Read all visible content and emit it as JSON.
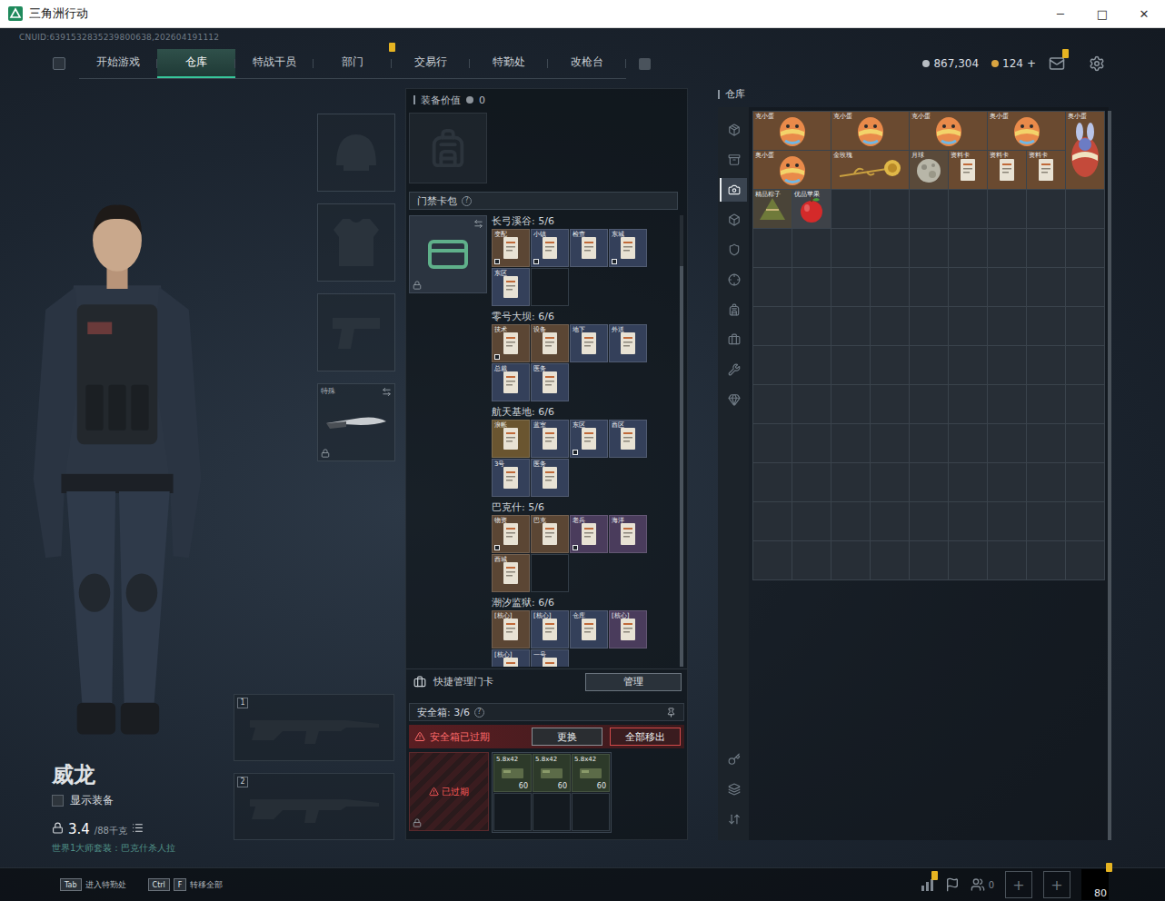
{
  "window": {
    "title": "三角洲行动",
    "controls": [
      "─",
      "□",
      "✕"
    ]
  },
  "header": {
    "uid": "CNUID:6391532835239800638,202604191112",
    "tabs": [
      {
        "label": "开始游戏",
        "selected": false,
        "badge": false
      },
      {
        "label": "仓库",
        "selected": true,
        "badge": false
      },
      {
        "label": "特战干员",
        "selected": false,
        "badge": false
      },
      {
        "label": "部门",
        "selected": false,
        "badge": true
      },
      {
        "label": "交易行",
        "selected": false,
        "badge": false
      },
      {
        "label": "特勤处",
        "selected": false,
        "badge": false
      },
      {
        "label": "改枪台",
        "selected": false,
        "badge": false
      }
    ],
    "currencies": [
      {
        "amount": "867,304",
        "color": "#b7bcc2"
      },
      {
        "amount": "124",
        "color": "#d9a441"
      }
    ],
    "add": "+",
    "mail_badge": true
  },
  "operator": {
    "name": "威龙",
    "show_equipment": {
      "label": "显示装备",
      "checked": false
    },
    "weight": "3.4",
    "weight_max": "/88千克",
    "status": "世界1大师套装：巴克什杀人拉"
  },
  "equipment": {
    "slots": [
      {
        "kind": "helmet",
        "filled": false,
        "locked": false
      },
      {
        "kind": "armor",
        "filled": false,
        "locked": false
      },
      {
        "kind": "pistol",
        "filled": false,
        "locked": false
      },
      {
        "kind": "melee",
        "filled": true,
        "label": "特殊",
        "locked": true
      }
    ],
    "weapons": [
      {
        "label": "1",
        "filled": false
      },
      {
        "label": "2",
        "filled": false
      }
    ]
  },
  "loadout": {
    "value_label": "装备价值",
    "value": "0",
    "backpack_filled": false,
    "keycards": {
      "title": "门禁卡包",
      "help": "?",
      "locked": true,
      "maps": [
        {
          "name": "长弓溪谷: 5/6",
          "capacity": 6,
          "cards": [
            {
              "label": "变配",
              "color": "#5b4634",
              "marked": true
            },
            {
              "label": "小镇",
              "color": "#34405a",
              "marked": true
            },
            {
              "label": "检查",
              "color": "#34405a",
              "marked": false
            },
            {
              "label": "东城",
              "color": "#34405a",
              "marked": true
            },
            {
              "label": "东区",
              "color": "#34405a",
              "marked": false
            }
          ]
        },
        {
          "name": "零号大坝: 6/6",
          "capacity": 6,
          "cards": [
            {
              "label": "技术",
              "color": "#5b4634",
              "marked": true
            },
            {
              "label": "设备",
              "color": "#5b4634",
              "marked": false
            },
            {
              "label": "地下",
              "color": "#34405a",
              "marked": false
            },
            {
              "label": "外送",
              "color": "#34405a",
              "marked": false
            },
            {
              "label": "总裁",
              "color": "#34405a",
              "marked": false
            },
            {
              "label": "医务",
              "color": "#34405a",
              "marked": false
            }
          ]
        },
        {
          "name": "航天基地: 6/6",
          "capacity": 6,
          "cards": [
            {
              "label": "浪帐",
              "color": "#6a5530",
              "marked": false
            },
            {
              "label": "蓝室",
              "color": "#34405a",
              "marked": false
            },
            {
              "label": "东区",
              "color": "#34405a",
              "marked": true
            },
            {
              "label": "西区",
              "color": "#34405a",
              "marked": false
            },
            {
              "label": "3号",
              "color": "#34405a",
              "marked": false
            },
            {
              "label": "医务",
              "color": "#34405a",
              "marked": false
            }
          ]
        },
        {
          "name": "巴克什: 5/6",
          "capacity": 6,
          "cards": [
            {
              "label": "物资",
              "color": "#5b4634",
              "marked": true
            },
            {
              "label": "巴克",
              "color": "#5b4634",
              "marked": false
            },
            {
              "label": "老兵",
              "color": "#4a3c5c",
              "marked": true
            },
            {
              "label": "海洋",
              "color": "#4a3c5c",
              "marked": false
            },
            {
              "label": "西城",
              "color": "#5b4634",
              "marked": false
            }
          ]
        },
        {
          "name": "潮汐监狱: 6/6",
          "capacity": 6,
          "cards": [
            {
              "label": "[核心]",
              "color": "#5b4634",
              "marked": false
            },
            {
              "label": "[核心]",
              "color": "#34405a",
              "marked": false
            },
            {
              "label": "仓库",
              "color": "#34405a",
              "marked": false
            },
            {
              "label": "[核心]",
              "color": "#4a3c5c",
              "marked": false
            },
            {
              "label": "[核心]",
              "color": "#34405a",
              "marked": false
            },
            {
              "label": "一号",
              "color": "#34405a",
              "marked": false
            }
          ]
        }
      ]
    },
    "quick_manage": {
      "label": "快捷管理门卡",
      "button": "管理"
    },
    "safe": {
      "title": "安全箱: 3/6",
      "help": "?",
      "warning": "安全箱已过期",
      "buttons": [
        "更换",
        "全部移出"
      ],
      "status": "已过期",
      "locked": true,
      "capacity": 6,
      "items": [
        {
          "label": "5.8x42",
          "count": "60"
        },
        {
          "label": "5.8x42",
          "count": "60"
        },
        {
          "label": "5.8x42",
          "count": "60"
        }
      ]
    }
  },
  "warehouse": {
    "title": "仓库",
    "tabs": [
      {
        "selected": false
      },
      {
        "selected": false
      },
      {
        "selected": true
      },
      {
        "selected": false
      },
      {
        "selected": false
      },
      {
        "selected": false
      },
      {
        "selected": false
      },
      {
        "selected": false
      },
      {
        "selected": false
      },
      {
        "selected": false
      },
      {
        "selected": false
      },
      {
        "selected": false
      },
      {
        "selected": false
      }
    ],
    "items": [
      {
        "kind": "egg",
        "label": "克小蛋",
        "color": "#6a4a30"
      },
      {
        "kind": "egg",
        "label": "克小蛋",
        "color": "#6a4a30"
      },
      {
        "kind": "egg",
        "label": "克小蛋",
        "color": "#6a4a30"
      },
      {
        "kind": "egg",
        "label": "奥小蛋",
        "color": "#6a4a30"
      },
      {
        "kind": "egg-tall",
        "label": "奥小蛋",
        "color": "#6a4a30"
      },
      {
        "kind": "egg",
        "label": "奥小蛋",
        "color": "#6a4a30"
      },
      {
        "kind": "rose",
        "label": "金玫瑰",
        "color": "#6a4a30"
      },
      {
        "kind": "moon",
        "label": "月球",
        "color": "#5a4a3a"
      },
      {
        "kind": "card",
        "label": "资料卡",
        "color": "#6a4a30"
      },
      {
        "kind": "card",
        "label": "资料卡",
        "color": "#6a4a30"
      },
      {
        "kind": "card",
        "label": "资料卡",
        "color": "#6a4a30"
      },
      {
        "kind": "zongzi",
        "label": "精品粽子",
        "color": "#4a4438"
      },
      {
        "kind": "apple",
        "label": "优品苹果",
        "color": "#3e4248"
      }
    ]
  },
  "footer": {
    "hints": [
      {
        "keys": [
          "Tab"
        ],
        "label": "进入特勤处"
      },
      {
        "keys": [
          "Ctrl",
          "F"
        ],
        "label": "转移全部"
      }
    ],
    "stats_badge": true,
    "friends": "0",
    "slots": [
      "+",
      "+"
    ],
    "level": "80",
    "level_badge": true
  }
}
